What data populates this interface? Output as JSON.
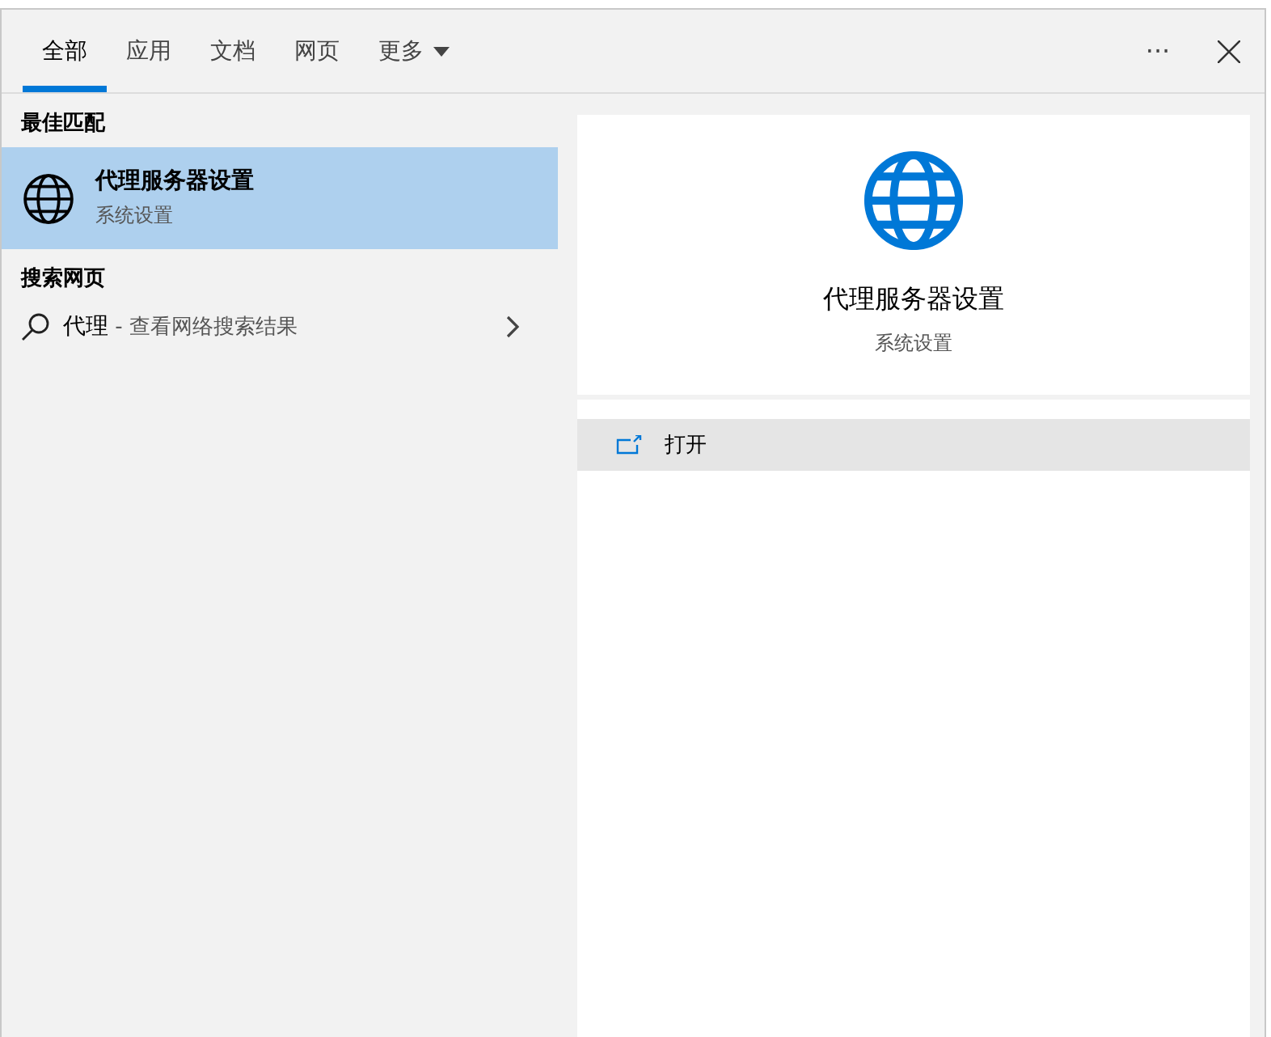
{
  "tabs": [
    {
      "label": "全部",
      "selected": true
    },
    {
      "label": "应用",
      "selected": false
    },
    {
      "label": "文档",
      "selected": false
    },
    {
      "label": "网页",
      "selected": false
    },
    {
      "label": "更多",
      "selected": false,
      "kind": "dropdown"
    }
  ],
  "header_actions": {
    "more": "···"
  },
  "best_match": {
    "heading": "最佳匹配",
    "items": [
      {
        "title": "代理服务器设置",
        "subtitle": "系统设置",
        "selected": true
      }
    ]
  },
  "web_search": {
    "heading": "搜索网页",
    "items": [
      {
        "query": "代理",
        "hint": " - 查看网络搜索结果"
      }
    ]
  },
  "detail": {
    "title": "代理服务器设置",
    "subtitle": "系统设置",
    "actions": [
      {
        "label": "打开",
        "selected": true
      }
    ]
  }
}
